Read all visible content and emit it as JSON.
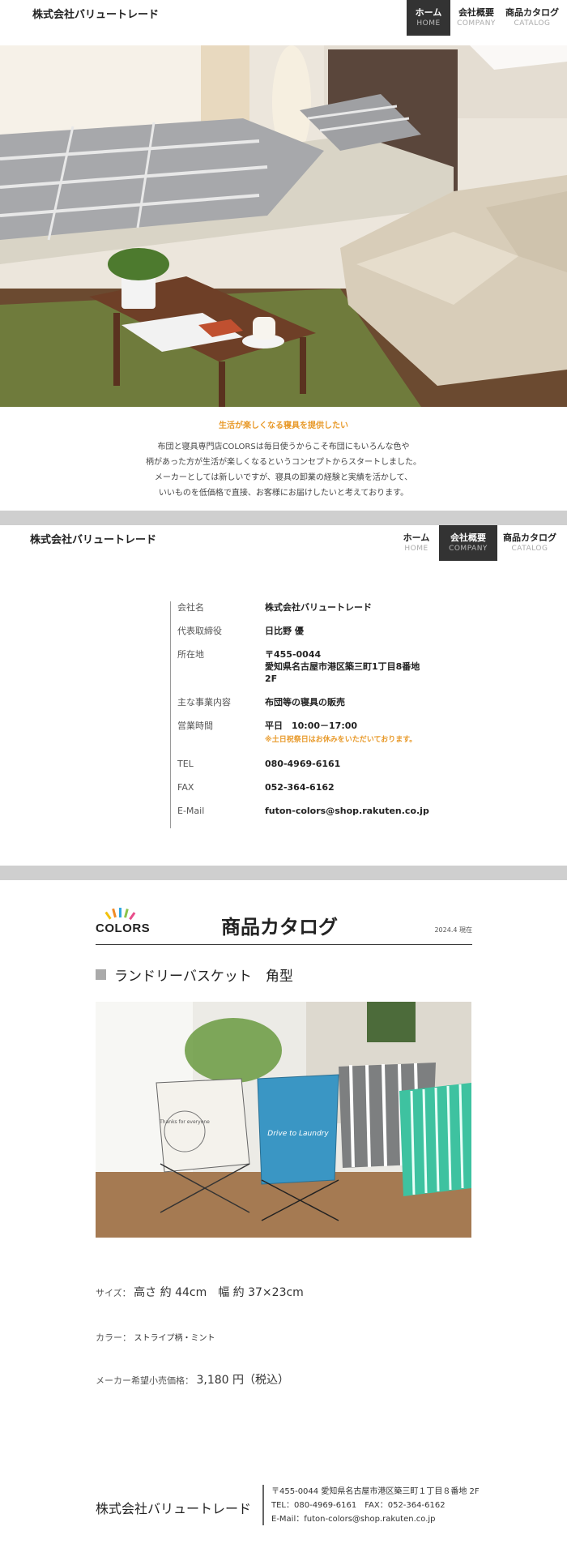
{
  "header": {
    "brand": "株式会社バリュートレード",
    "nav": [
      {
        "ja": "ホーム",
        "en": "HOME"
      },
      {
        "ja": "会社概要",
        "en": "COMPANY"
      },
      {
        "ja": "商品カタログ",
        "en": "CATALOG"
      }
    ]
  },
  "top": {
    "tagline": "生活が楽しくなる寝具を提供したい",
    "intro": [
      "布団と寝具専門店COLORSは毎日使うからこそ布団にもいろんな色や",
      "柄があった方が生活が楽しくなるというコンセプトからスタートしました。",
      "メーカーとしては新しいですが、寝具の卸業の経験と実績を活かして、",
      "いいものを低価格で直接、お客様にお届けしたいと考えております。"
    ]
  },
  "company": {
    "rows": [
      {
        "label": "会社名",
        "value": "株式会社バリュートレード"
      },
      {
        "label": "代表取締役",
        "value": "日比野 優"
      },
      {
        "label": "所在地",
        "value": "〒455-0044",
        "value2": "愛知県名古屋市港区築三町1丁目8番地　2F"
      },
      {
        "label": "主な事業内容",
        "value": "布団等の寝具の販売"
      },
      {
        "label": "営業時間",
        "value": "平日　10:00－17:00",
        "note": "※土日祝祭日はお休みをいただいております。"
      },
      {
        "label": "TEL",
        "value": "080-4969-6161"
      },
      {
        "label": "FAX",
        "value": "052-364-6162"
      },
      {
        "label": "E-Mail",
        "value": "futon-colors@shop.rakuten.co.jp"
      }
    ]
  },
  "catalog": {
    "logo": "COLORS",
    "title": "商品カタログ",
    "date": "2024.4 現在",
    "product_name": "ランドリーバスケット　角型",
    "image_labels": {
      "white": "Thanks for everyone",
      "blue": "Drive to Laundry"
    },
    "size_label": "サイズ：",
    "size_value": "高さ 約 44cm　幅 約 37×23cm",
    "color_label": "カラー：",
    "color_value": "ストライプ柄・ミント",
    "price_label": "メーカー希望小売価格：",
    "price_value": "3,180 円（税込）"
  },
  "footer": {
    "brand": "株式会社バリュートレード",
    "address": "〒455-0044 愛知県名古屋市港区築三町１丁目８番地 2F",
    "tel_fax": "TEL：080-4969-6161　FAX：052-364-6162",
    "email": "E-Mail：futon-colors@shop.rakuten.co.jp"
  },
  "colors": {
    "accent": "#e89a2b",
    "nav_active": "#333333",
    "divider": "#cfcfcf"
  }
}
